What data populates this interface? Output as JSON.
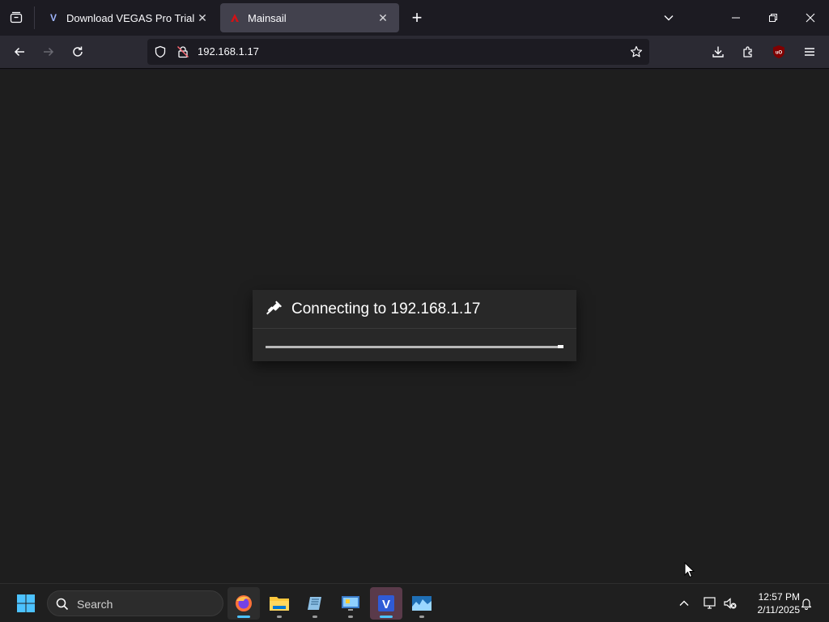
{
  "browser": {
    "tabs": [
      {
        "label": "Download VEGAS Pro Trials for",
        "favicon": "V",
        "active": false
      },
      {
        "label": "Mainsail",
        "favicon": "mainsail-logo",
        "active": true
      }
    ],
    "url": "192.168.1.17"
  },
  "dialog": {
    "title": "Connecting to 192.168.1.17",
    "icon": "plug-icon",
    "progress": 1.0
  },
  "taskbar": {
    "search_placeholder": "Search",
    "time": "12:57 PM",
    "date": "2/11/2025",
    "apps": [
      "firefox",
      "file-explorer",
      "notepad-app",
      "control-panel",
      "vegas-pro",
      "photo-app"
    ]
  },
  "colors": {
    "accent": "#4cc2ff",
    "mainsail_red": "#d41216",
    "vegas_blue": "#3b5bdb",
    "ublock_red": "#800000"
  }
}
